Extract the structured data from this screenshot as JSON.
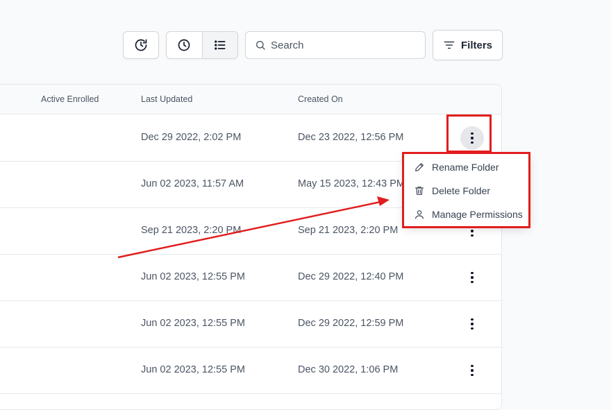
{
  "toolbar": {
    "history_icon": "history-icon",
    "clock_icon": "clock-icon",
    "list_icon": "list-icon",
    "search": {
      "placeholder": "Search",
      "value": ""
    },
    "filters_label": "Filters"
  },
  "table": {
    "columns": [
      "Active Enrolled",
      "Last Updated",
      "Created On"
    ],
    "rows": [
      {
        "last_updated": "Dec 29 2022, 2:02 PM",
        "created_on": "Dec 23 2022, 12:56 PM"
      },
      {
        "last_updated": "Jun 02 2023, 11:57 AM",
        "created_on": "May 15 2023, 12:43 PM"
      },
      {
        "last_updated": "Sep 21 2023, 2:20 PM",
        "created_on": "Sep 21 2023, 2:20 PM"
      },
      {
        "last_updated": "Jun 02 2023, 12:55 PM",
        "created_on": "Dec 29 2022, 12:40 PM"
      },
      {
        "last_updated": "Jun 02 2023, 12:55 PM",
        "created_on": "Dec 29 2022, 12:59 PM"
      },
      {
        "last_updated": "Jun 02 2023, 12:55 PM",
        "created_on": "Dec 30 2022, 1:06 PM"
      }
    ]
  },
  "context_menu": {
    "items": [
      {
        "label": "Rename Folder",
        "icon": "pencil-icon"
      },
      {
        "label": "Delete Folder",
        "icon": "trash-icon"
      },
      {
        "label": "Manage Permissions",
        "icon": "user-icon"
      }
    ]
  },
  "annotation_color": "#e11d1d"
}
